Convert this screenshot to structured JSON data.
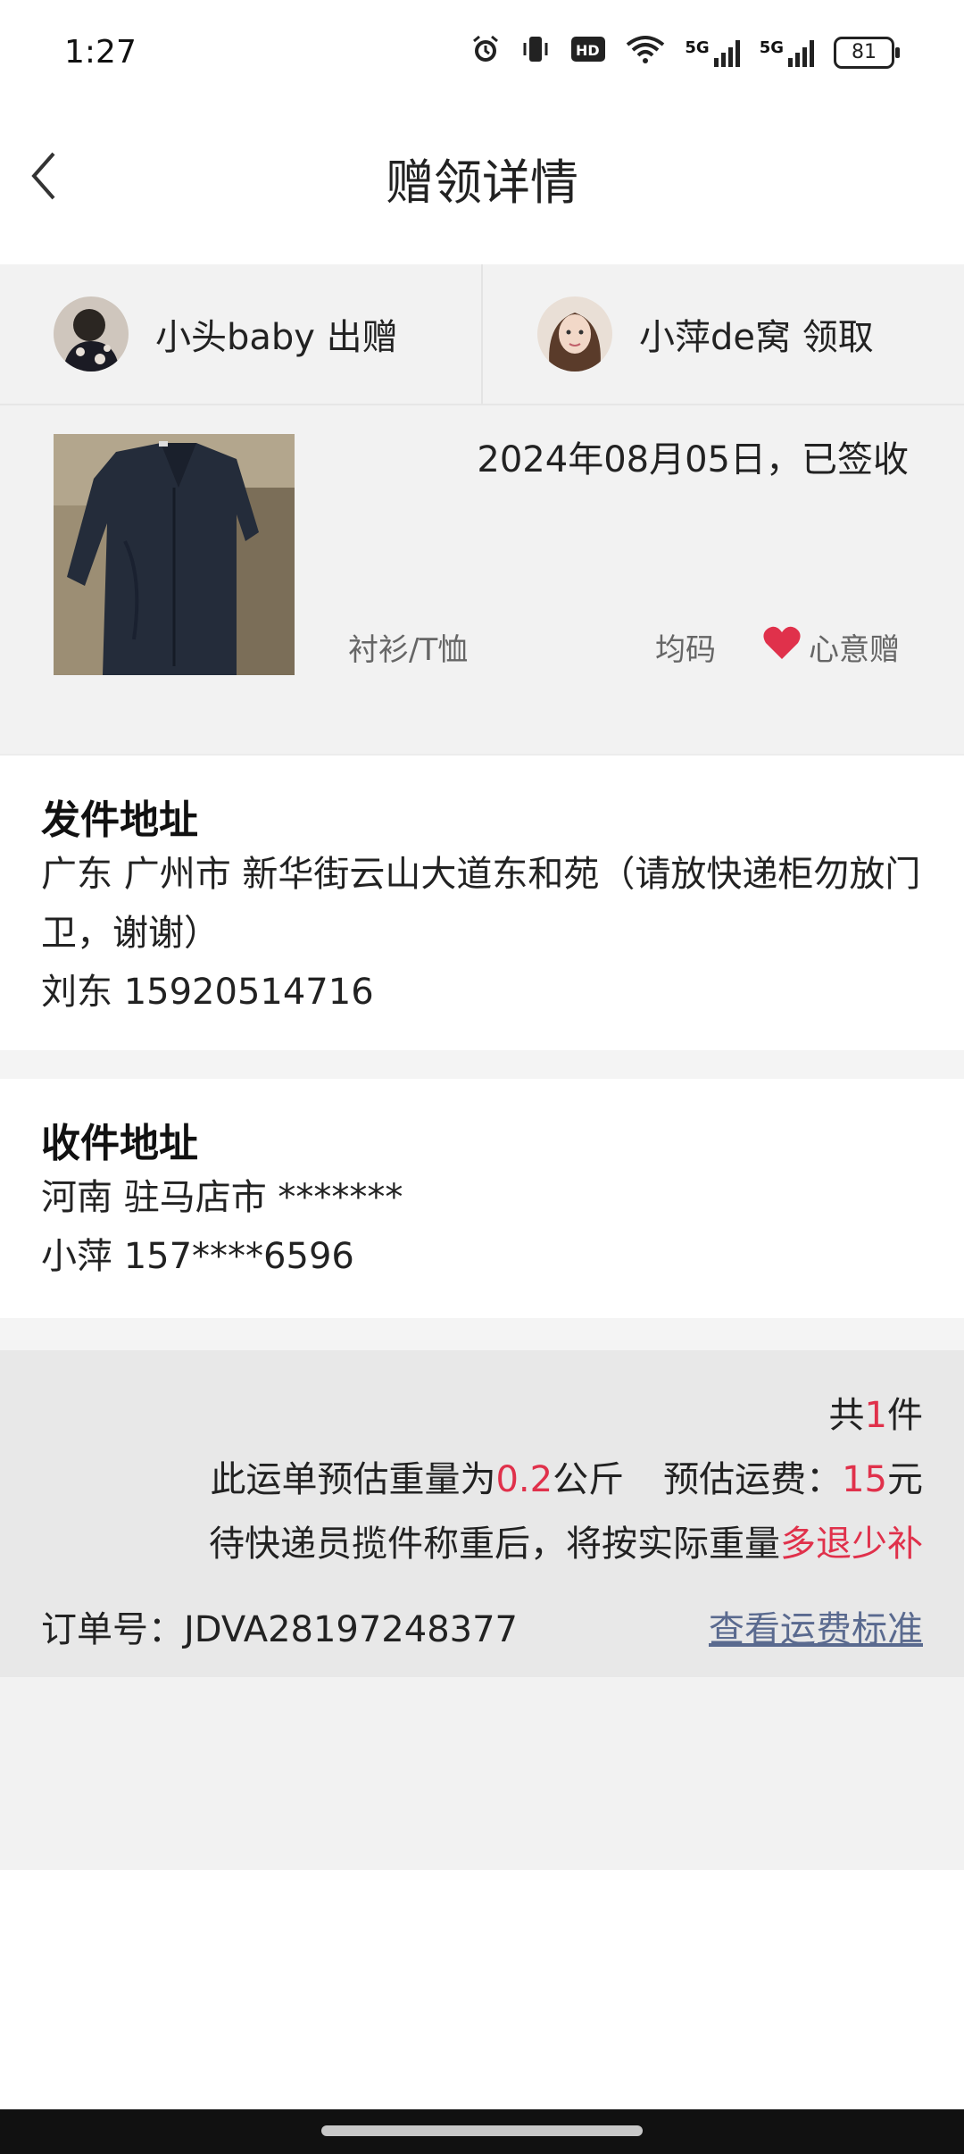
{
  "status_bar": {
    "time": "1:27",
    "battery": "81"
  },
  "header": {
    "title": "赠领详情"
  },
  "users": {
    "giver": {
      "name_text": "小头baby 出赠"
    },
    "receiver": {
      "name_text": "小萍de窝 领取"
    }
  },
  "item": {
    "date_status": "2024年08月05日，已签收",
    "category": "衬衫/T恤",
    "size": "均码",
    "gift_type": "心意赠"
  },
  "sender": {
    "title": "发件地址",
    "address": "广东 广州市 新华街云山大道东和苑（请放快递柜勿放门卫，谢谢）",
    "contact": "刘东 15920514716"
  },
  "receiver_addr": {
    "title": "收件地址",
    "address": "河南 驻马店市 *******",
    "contact": "小萍 157****6596"
  },
  "summary": {
    "count_prefix": "共",
    "count": "1",
    "count_suffix": "件",
    "weight_prefix": "此运单预估重量为",
    "weight": "0.2",
    "weight_unit": "公斤",
    "fee_label": "预估运费：",
    "fee": "15",
    "fee_unit": "元",
    "note_prefix": "待快递员揽件称重后，将按实际重量",
    "note_highlight": "多退少补",
    "order_label": "订单号：",
    "order_no": "JDVA28197248377",
    "fee_link": "查看运费标准"
  },
  "colors": {
    "accent_red": "#e0314b",
    "link": "#5a6a8f"
  }
}
